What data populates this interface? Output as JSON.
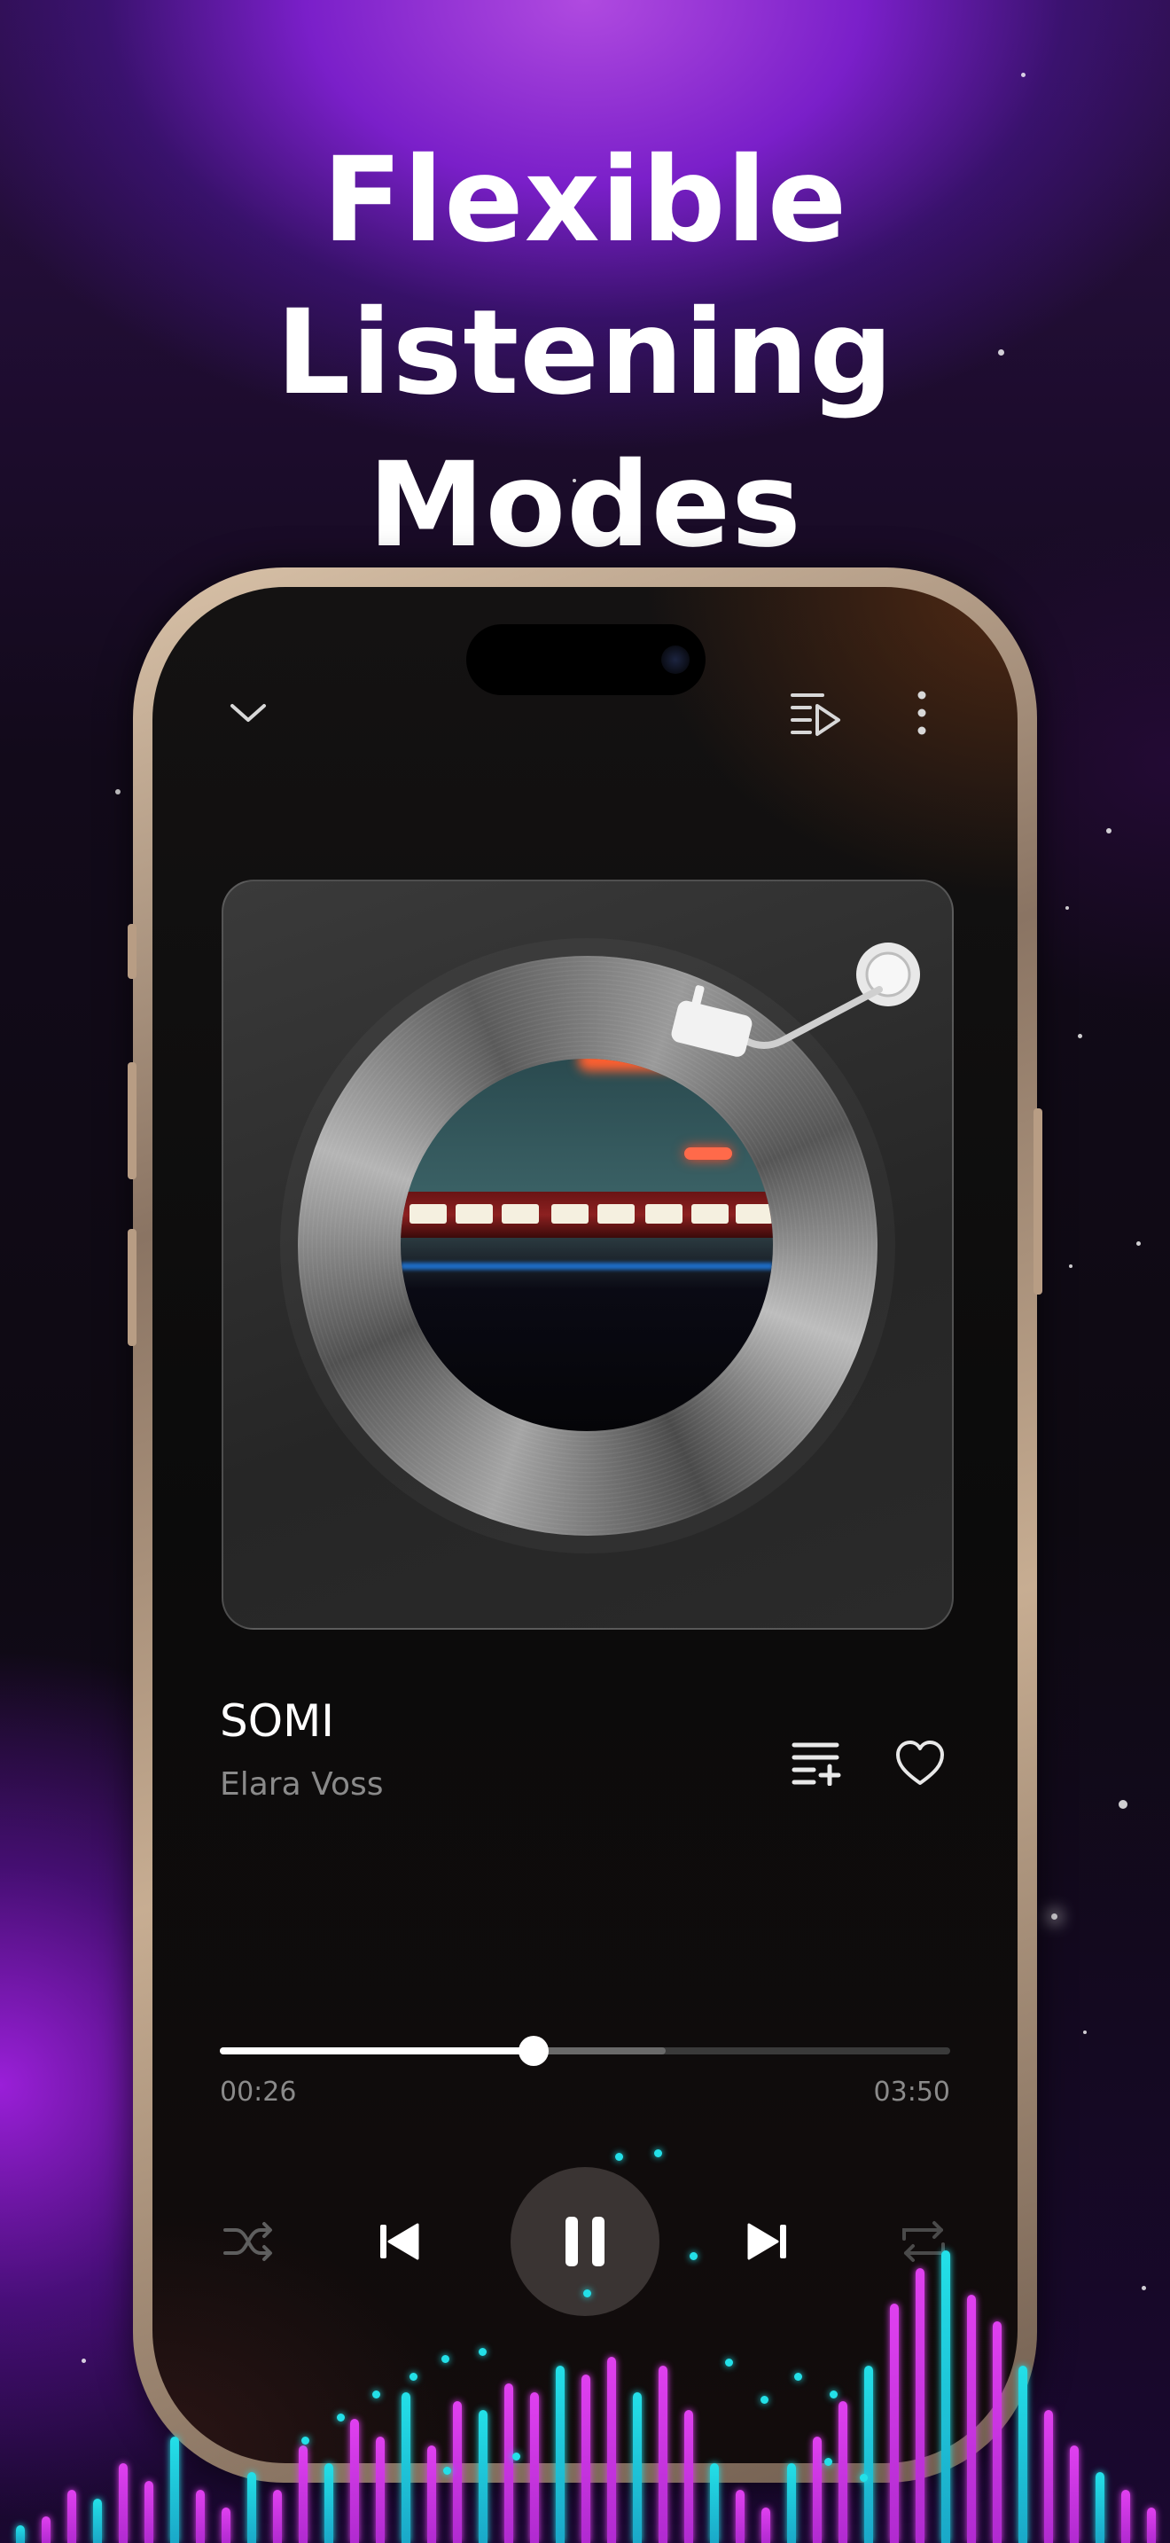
{
  "headline": {
    "line1": "Flexible Listening",
    "line2": "Modes"
  },
  "player": {
    "collapse_icon": "chevron-down-icon",
    "queue_icon": "playlist-play-icon",
    "more_icon": "more-vertical-icon",
    "track": {
      "title": "SOMI",
      "artist": "Elara Voss"
    },
    "add_to_playlist_icon": "playlist-add-icon",
    "favorite_icon": "heart-outline-icon",
    "progress": {
      "elapsed": "00:26",
      "duration": "03:50",
      "played_fraction": 0.43,
      "buffered_fraction": 0.61
    },
    "controls": {
      "shuffle_icon": "shuffle-icon",
      "previous_icon": "skip-previous-icon",
      "play_pause_icon": "pause-icon",
      "next_icon": "skip-next-icon",
      "repeat_icon": "repeat-icon"
    }
  },
  "colors": {
    "accent_purple": "#9a1fd8",
    "equalizer_magenta": "#e040f0",
    "equalizer_cyan": "#23e0e8",
    "progress_fill": "#ffffff"
  }
}
